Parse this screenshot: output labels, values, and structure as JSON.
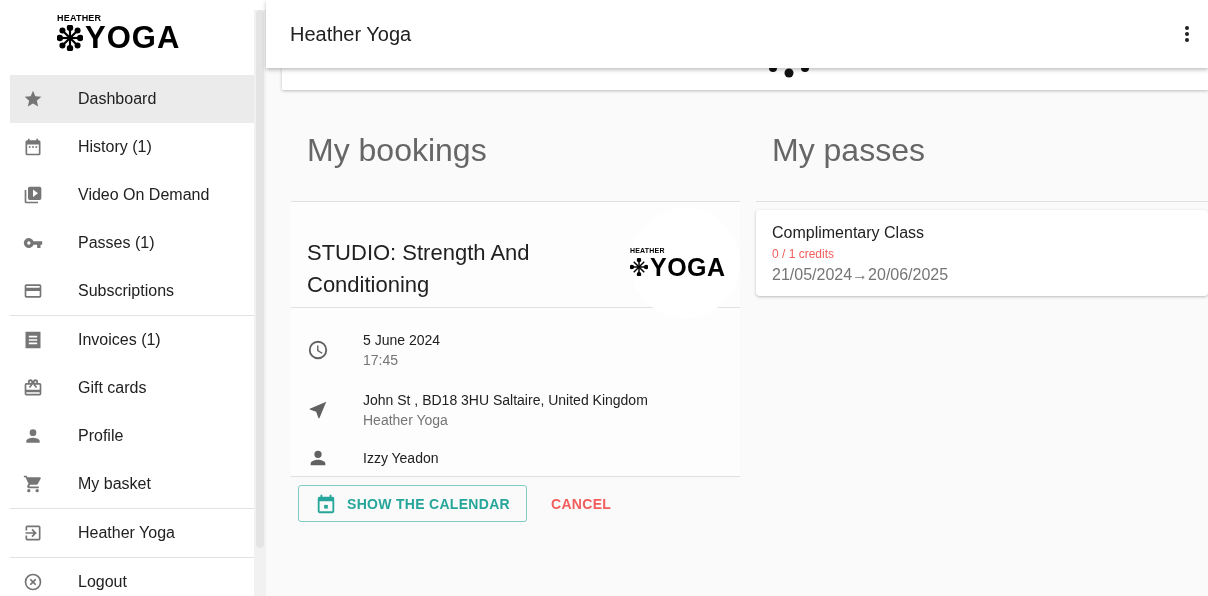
{
  "sidebar": {
    "logo": {
      "small": "HEATHER",
      "large": "YOGA"
    },
    "sections": [
      {
        "items": [
          {
            "label": "Dashboard",
            "kind": "star",
            "selected": true
          },
          {
            "label": "History (1)",
            "kind": "calendar",
            "selected": false
          },
          {
            "label": "Video On Demand",
            "kind": "video",
            "selected": false
          },
          {
            "label": "Passes (1)",
            "kind": "key",
            "selected": false
          },
          {
            "label": "Subscriptions",
            "kind": "card",
            "selected": false
          }
        ]
      },
      {
        "items": [
          {
            "label": "Invoices (1)",
            "kind": "invoice",
            "selected": false
          },
          {
            "label": "Gift cards",
            "kind": "gift",
            "selected": false
          },
          {
            "label": "Profile",
            "kind": "person",
            "selected": false
          },
          {
            "label": "My basket",
            "kind": "cart",
            "selected": false
          }
        ]
      },
      {
        "items": [
          {
            "label": "Heather Yoga",
            "kind": "login",
            "selected": false
          }
        ]
      },
      {
        "items": [
          {
            "label": "Logout",
            "kind": "cancel",
            "selected": false
          }
        ]
      }
    ]
  },
  "header": {
    "title": "Heather Yoga"
  },
  "bookings": {
    "heading": "My bookings",
    "booking": {
      "title": "STUDIO: Strength And Conditioning",
      "logo": {
        "small": "HEATHER",
        "large": "YOGA"
      },
      "details": [
        {
          "kind": "clock",
          "primary": "5 June 2024",
          "secondary": "17:45"
        },
        {
          "kind": "navigate",
          "primary": "John St , BD18 3HU Saltaire, United Kingdom",
          "secondary": "Heather Yoga"
        },
        {
          "kind": "person",
          "primary": "Izzy Yeadon"
        }
      ],
      "buttons": [
        {
          "label": "SHOW THE CALENDAR",
          "kind": "outlined"
        },
        {
          "label": "CANCEL",
          "kind": "text"
        }
      ]
    }
  },
  "passes": {
    "heading": "My passes",
    "items": [
      {
        "name": "Complimentary Class",
        "credits": "0 / 1 credits",
        "period": "21/05/2024→20/06/2025"
      }
    ]
  }
}
